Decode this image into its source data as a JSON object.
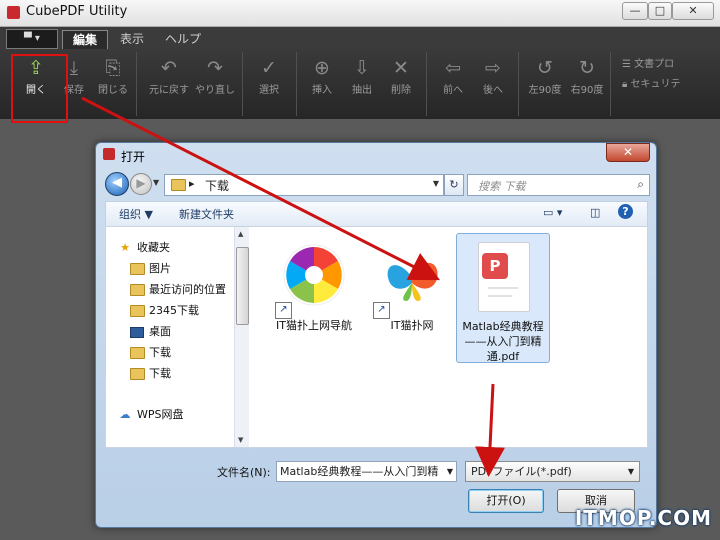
{
  "app": {
    "title": "CubePDF Utility",
    "window_controls": [
      "—",
      "□",
      "✕"
    ]
  },
  "tabs": {
    "file_menu": "▀ ▾",
    "items": [
      "編集",
      "表示",
      "ヘルプ"
    ],
    "active": "編集"
  },
  "ribbon": {
    "buttons": [
      "開く",
      "保存",
      "閉じる",
      "元に戻す",
      "やり直し",
      "選択",
      "挿入",
      "抽出",
      "削除",
      "前へ",
      "後へ",
      "左90度",
      "右90度"
    ],
    "side": [
      "文書プロ",
      "セキュリテ"
    ],
    "icons": [
      "open-icon",
      "save-icon",
      "close-icon",
      "undo-icon",
      "redo-icon",
      "select-icon",
      "insert-icon",
      "extract-icon",
      "delete-icon",
      "previous-icon",
      "next-icon",
      "rotate-left-icon",
      "rotate-right-icon"
    ]
  },
  "dialog": {
    "title": "打开",
    "address": {
      "path": "下载",
      "separator": "▸"
    },
    "search_placeholder": "搜索 下载",
    "toolbar": {
      "organize": "组织 ▼",
      "new_folder": "新建文件夹"
    },
    "nav_pane": [
      "收藏夹",
      "图片",
      "最近访问的位置",
      "2345下载",
      "桌面",
      "下载",
      "下载",
      "WPS网盘"
    ],
    "files": [
      {
        "name": "IT猫扑上网导航",
        "icon": "browser-shortcut-icon"
      },
      {
        "name": "IT猫扑网",
        "icon": "butterfly-shortcut-icon"
      },
      {
        "name": "Matlab经典教程——从入门到精通.pdf",
        "icon": "pdf-file-icon",
        "selected": true
      }
    ],
    "filename_label": "文件名(N):",
    "filename_value": "Matlab经典教程——从入门到精",
    "filetype_value": "PDFファイル(*.pdf)",
    "open_button": "打开(O)",
    "cancel_button": "取消"
  },
  "watermark": "ITMOP.COM",
  "colors": {
    "highlight": "#e01010",
    "arrow": "#cc1111",
    "pdf_badge": "#e04c4c",
    "selection": "#d9e8fb"
  }
}
